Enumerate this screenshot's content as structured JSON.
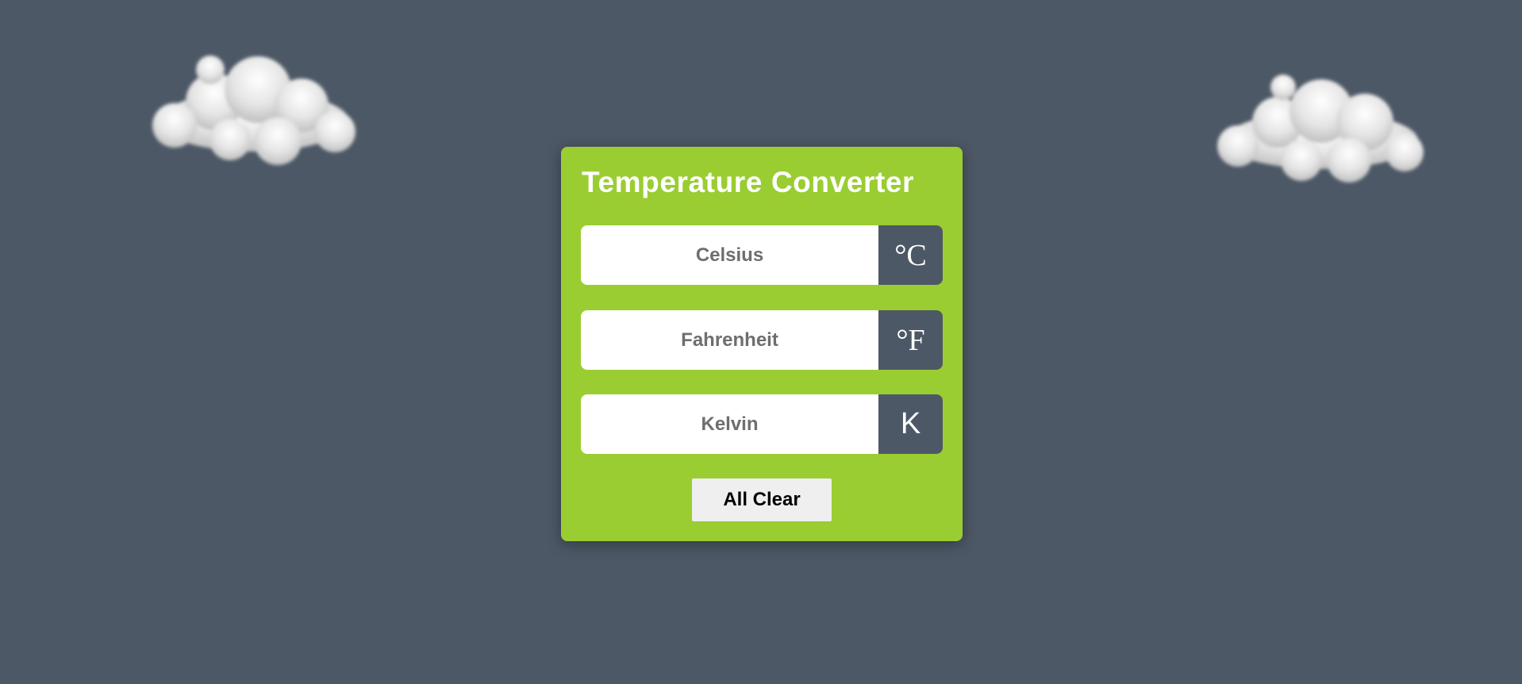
{
  "background_color": "#4d5866",
  "decor": {
    "clouds": [
      {
        "name": "cloud-left",
        "icon": "cloud-image"
      },
      {
        "name": "cloud-right",
        "icon": "cloud-image"
      }
    ]
  },
  "converter": {
    "accent_color": "#9acd32",
    "title": "Temperature Converter",
    "fields": [
      {
        "placeholder": "Celsius",
        "value": "",
        "unit": "°C",
        "icon": "celsius-symbol"
      },
      {
        "placeholder": "Fahrenheit",
        "value": "",
        "unit": "°F",
        "icon": "fahrenheit-symbol"
      },
      {
        "placeholder": "Kelvin",
        "value": "",
        "unit": "K",
        "icon": "kelvin-symbol"
      }
    ],
    "clear_label": "All Clear"
  }
}
